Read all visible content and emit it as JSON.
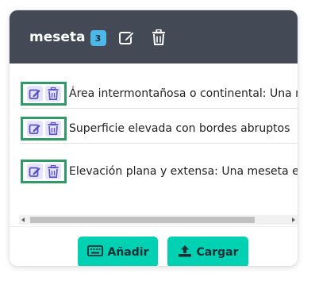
{
  "header": {
    "title": "meseta",
    "badge_count": "3",
    "edit_icon": "edit-icon",
    "delete_icon": "trash-icon"
  },
  "items": [
    {
      "text": "Área intermontañosa o continental: Una meseta es una llanura elevada"
    },
    {
      "text": "Superficie elevada con bordes abruptos"
    },
    {
      "text": "Elevación plana y extensa: Una meseta es un terreno elevado"
    }
  ],
  "buttons": {
    "add_label": "Añadir",
    "upload_label": "Cargar",
    "add_icon": "keyboard-icon",
    "upload_icon": "upload-icon"
  },
  "colors": {
    "header_bg": "#434955",
    "badge_bg": "#4bb8e8",
    "button_bg": "#00d1b2",
    "action_border": "#2e9b66",
    "action_icon": "#5a4fc4"
  }
}
